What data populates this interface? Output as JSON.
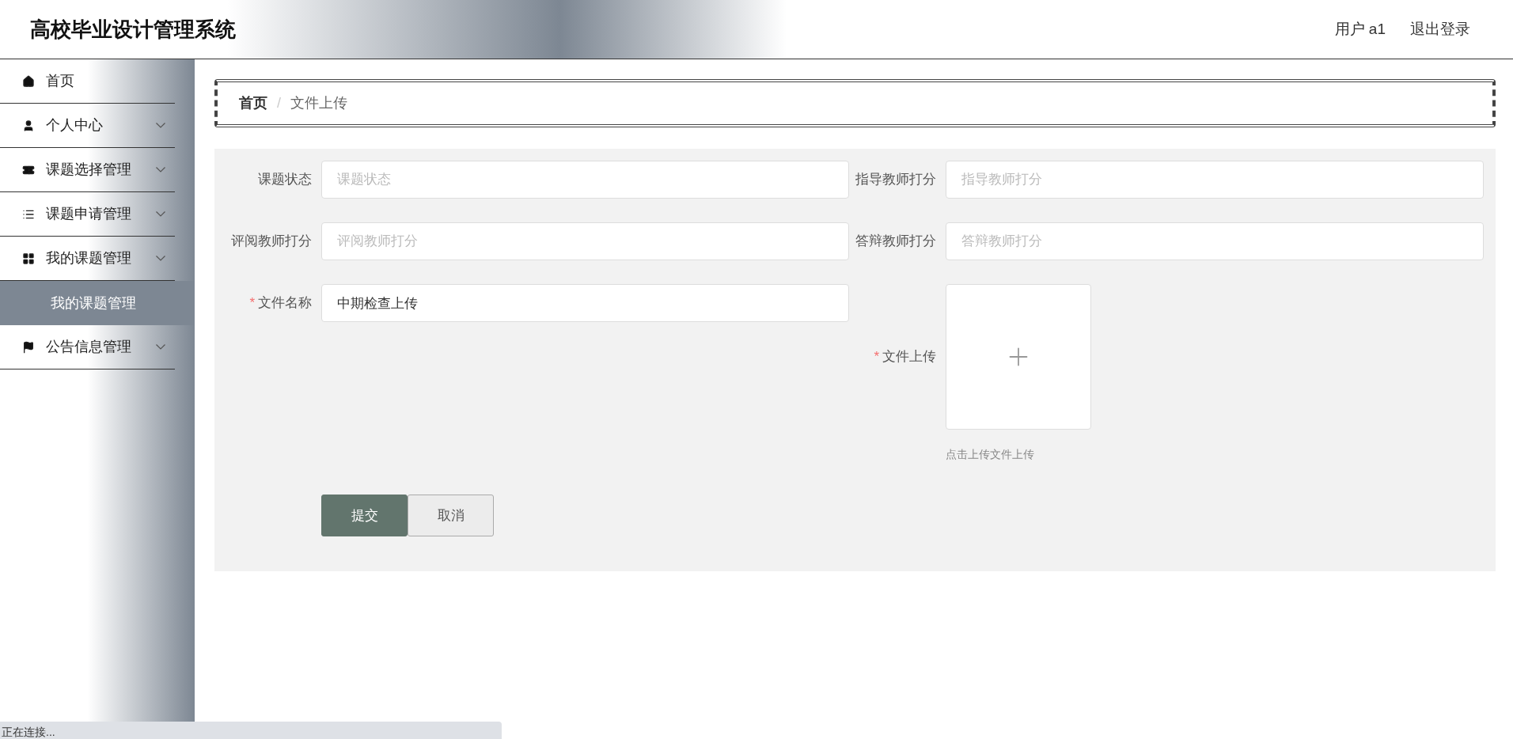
{
  "header": {
    "title": "高校毕业设计管理系统",
    "user": "用户 a1",
    "logout": "退出登录"
  },
  "sidebar": {
    "items": [
      {
        "label": "首页",
        "kind": "link"
      },
      {
        "label": "个人中心",
        "kind": "menu"
      },
      {
        "label": "课题选择管理",
        "kind": "menu"
      },
      {
        "label": "课题申请管理",
        "kind": "menu"
      },
      {
        "label": "我的课题管理",
        "kind": "menu",
        "children": [
          {
            "label": "我的课题管理",
            "selected": true
          }
        ]
      },
      {
        "label": "公告信息管理",
        "kind": "menu"
      }
    ]
  },
  "breadcrumb": {
    "items": [
      "首页",
      "文件上传"
    ],
    "separator": "/"
  },
  "form": {
    "fields": [
      {
        "kind": "input",
        "label": "课题状态",
        "placeholder": "课题状态"
      },
      {
        "kind": "input",
        "label": "指导教师打分",
        "placeholder": "指导教师打分"
      },
      {
        "kind": "input",
        "label": "评阅教师打分",
        "placeholder": "评阅教师打分"
      },
      {
        "kind": "input",
        "label": "答辩教师打分",
        "placeholder": "答辩教师打分"
      },
      {
        "kind": "input",
        "label": "文件名称",
        "value": "中期检查上传",
        "required_mark": "*"
      },
      {
        "kind": "upload",
        "label": "文件上传",
        "hint": "点击上传文件上传",
        "required_mark": "*"
      }
    ],
    "buttons": [
      {
        "label": "提交",
        "kind": "primary"
      },
      {
        "label": "取消",
        "kind": "default"
      }
    ]
  },
  "status_bar": "正在连接..."
}
